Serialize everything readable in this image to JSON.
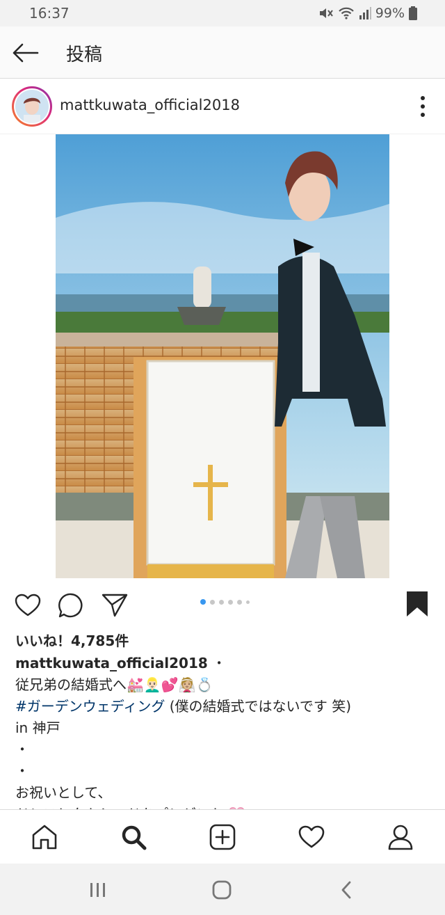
{
  "status_bar": {
    "time": "16:37",
    "battery": "99%"
  },
  "app_bar": {
    "title": "投稿"
  },
  "post": {
    "username": "mattkuwata_official2018",
    "likes": "いいね！4,785件",
    "caption": {
      "username": "mattkuwata_official2018",
      "separator": " ・",
      "line1": "従兄弟の結婚式へ💒👱🏻‍♂️💕👰🏼💍",
      "hashtag": "#ガーデンウェディング",
      "line2_rest": " (僕の結婚式ではないです 笑)",
      "line3": "in 神戸",
      "line4": "・",
      "line5": "・",
      "line6": "お祝いとして、",
      "line7": "ドレスとタキシードをプレゼント 💗"
    },
    "carousel": {
      "count": 6,
      "active_index": 0
    }
  },
  "colors": {
    "accent": "#3897f0",
    "text": "#262626",
    "hashtag": "#003569"
  },
  "icons": {
    "back": "arrow-left-icon",
    "more": "more-vertical-icon",
    "like": "heart-icon",
    "comment": "comment-icon",
    "share": "send-icon",
    "save": "bookmark-icon",
    "nav": [
      "home-icon",
      "search-icon",
      "add-post-icon",
      "activity-heart-icon",
      "profile-icon"
    ]
  }
}
